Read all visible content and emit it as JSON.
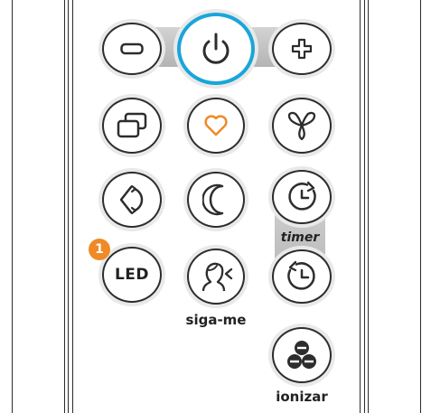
{
  "colors": {
    "accent": "#19a6d9",
    "heart": "#f08a26",
    "badge": "#f08a26",
    "stroke": "#2d2d2d"
  },
  "buttons": {
    "minus": {
      "icon": "minus-icon"
    },
    "power": {
      "icon": "power-icon"
    },
    "plus": {
      "icon": "plus-icon"
    },
    "windows": {
      "icon": "overlapping-windows-icon"
    },
    "heart": {
      "icon": "heart-icon"
    },
    "fan": {
      "icon": "fan-blades-icon"
    },
    "swing": {
      "icon": "swing-arrows-icon"
    },
    "sleep": {
      "icon": "moon-icon"
    },
    "timer_on": {
      "icon": "clock-forward-icon"
    },
    "led": {
      "text": "LED"
    },
    "follow_me": {
      "icon": "person-face-icon"
    },
    "timer_off": {
      "icon": "clock-backward-icon"
    },
    "ionizer": {
      "icon": "ion-circles-icon"
    }
  },
  "labels": {
    "timer": "timer",
    "follow_me": "siga-me",
    "ionizer": "ionizar"
  },
  "badge": {
    "number": "1"
  }
}
